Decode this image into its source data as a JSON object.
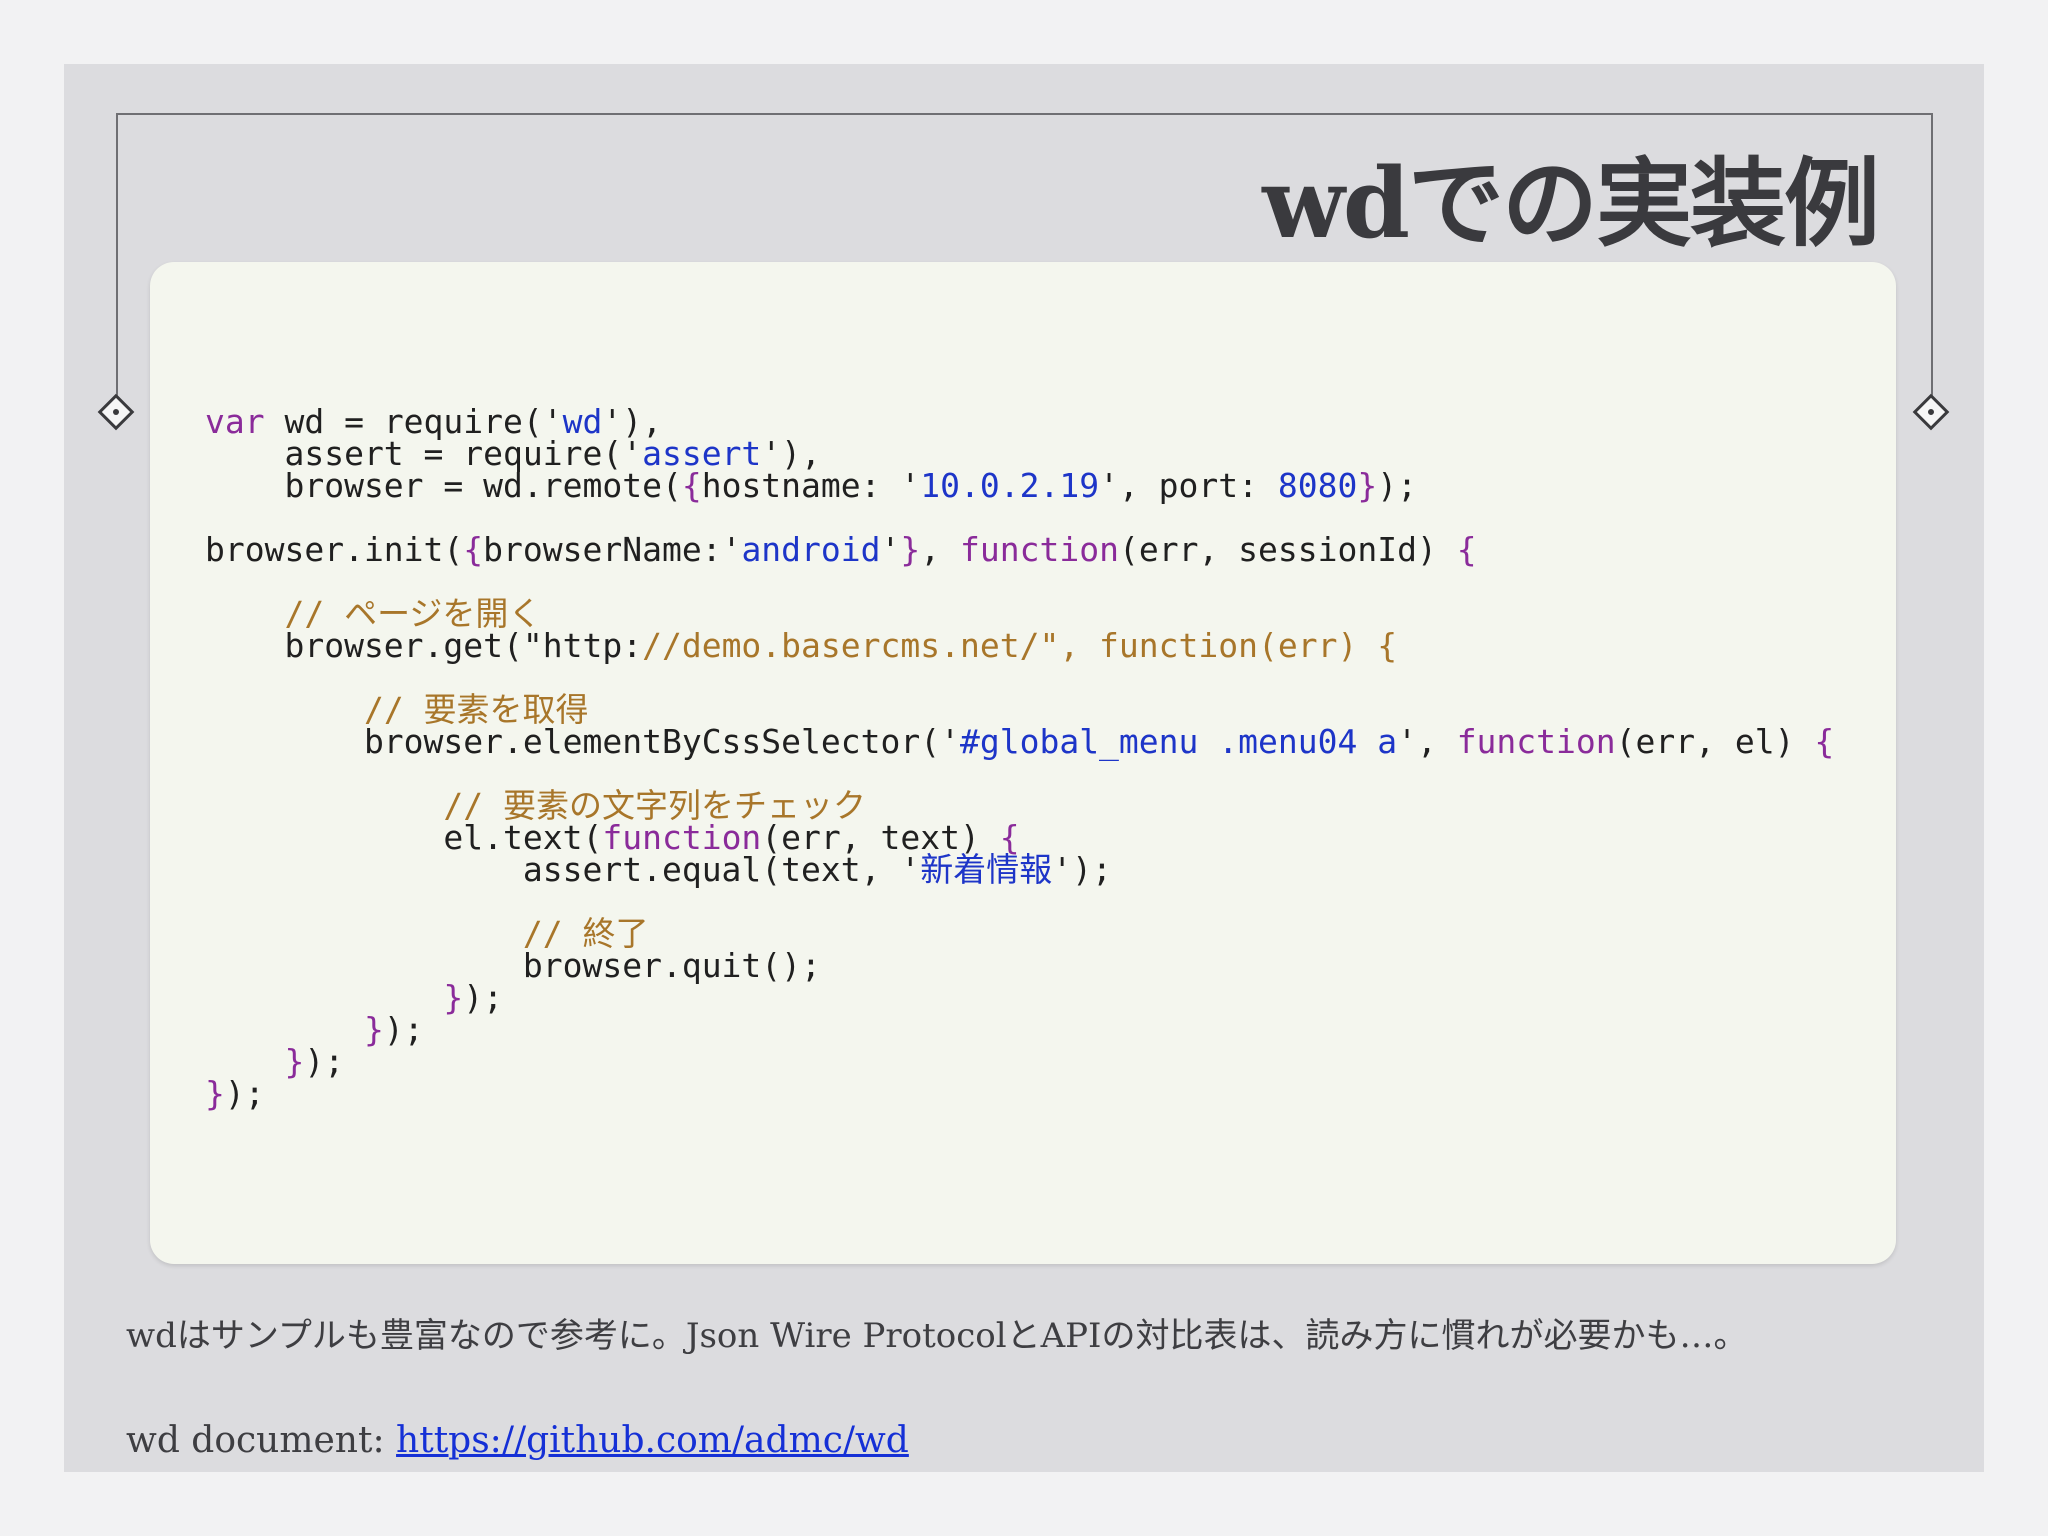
{
  "slide": {
    "title": "wdでの実装例",
    "caption": "wdはサンプルも豊富なので参考に。Json Wire ProtocolとAPIの対比表は、読み方に慣れが必要かも…。",
    "doc_label": "wd document: ",
    "doc_link": "https://github.com/admc/wd"
  },
  "code": {
    "language": "javascript",
    "lines": [
      "var wd = require('wd'),",
      "    assert = require('assert'),",
      "    browser = wd.remote({hostname: '10.0.2.19', port: 8080});",
      "",
      "browser.init({browserName:'android'}, function(err, sessionId) {",
      "",
      "    // ページを開く",
      "    browser.get(\"http://demo.basercms.net/\", function(err) {",
      "",
      "        // 要素を取得",
      "        browser.elementByCssSelector('#global_menu .menu04 a', function(err, el) {",
      "",
      "            // 要素の文字列をチェック",
      "            el.text(function(err, text) {",
      "                assert.equal(text, '新着情報');",
      "",
      "                // 終了",
      "                browser.quit();",
      "            });",
      "        });",
      "    });",
      "});"
    ]
  },
  "colors": {
    "keyword": "#8a2b9a",
    "string": "#1d35c8",
    "comment": "#a8762a",
    "link": "#1530d6"
  }
}
